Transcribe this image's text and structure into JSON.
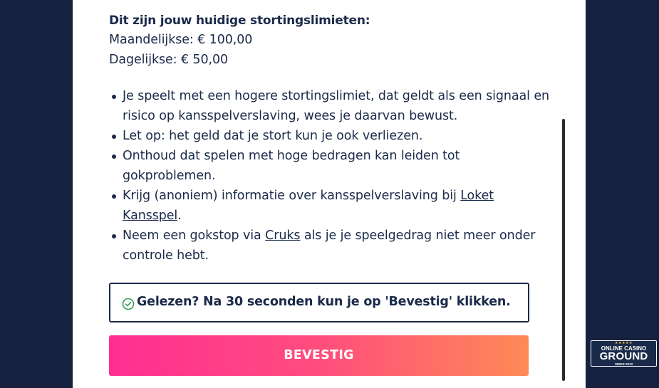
{
  "limits": {
    "heading": "Dit zijn jouw huidige stortingslimieten:",
    "monthly": "Maandelijkse: € 100,00",
    "daily": "Dagelijkse: € 50,00"
  },
  "warnings": [
    {
      "text": "Je speelt met een hogere stortingslimiet, dat geldt als een signaal en risico op kansspelverslaving, wees je daarvan bewust."
    },
    {
      "text": "Let op: het geld dat je stort kun je ook verliezen."
    },
    {
      "text": "Onthoud dat spelen met hoge bedragen kan leiden tot gokproblemen."
    },
    {
      "before": "Krijg (anoniem) informatie over kansspelverslaving bij ",
      "link": "Loket Kansspel",
      "after": "."
    },
    {
      "before": "Neem een gokstop via ",
      "link": "Cruks",
      "after": " als je je speelgedrag niet meer onder controle hebt."
    }
  ],
  "notice": {
    "icon": "check-circle-icon",
    "text": "Gelezen? Na 30 seconden kun je op 'Bevestig' klikken."
  },
  "confirm_button": {
    "label": "BEVESTIG"
  },
  "badge": {
    "stars": "★★★★★",
    "line1": "ONLINE CASINO",
    "line2": "GROUND",
    "line3": "SINDS 2013"
  },
  "colors": {
    "background": "#15213e",
    "text": "#1b2a4a",
    "button_gradient_start": "#ff2e93",
    "button_gradient_end": "#ff8a55",
    "check_icon": "#2e9e5b"
  }
}
